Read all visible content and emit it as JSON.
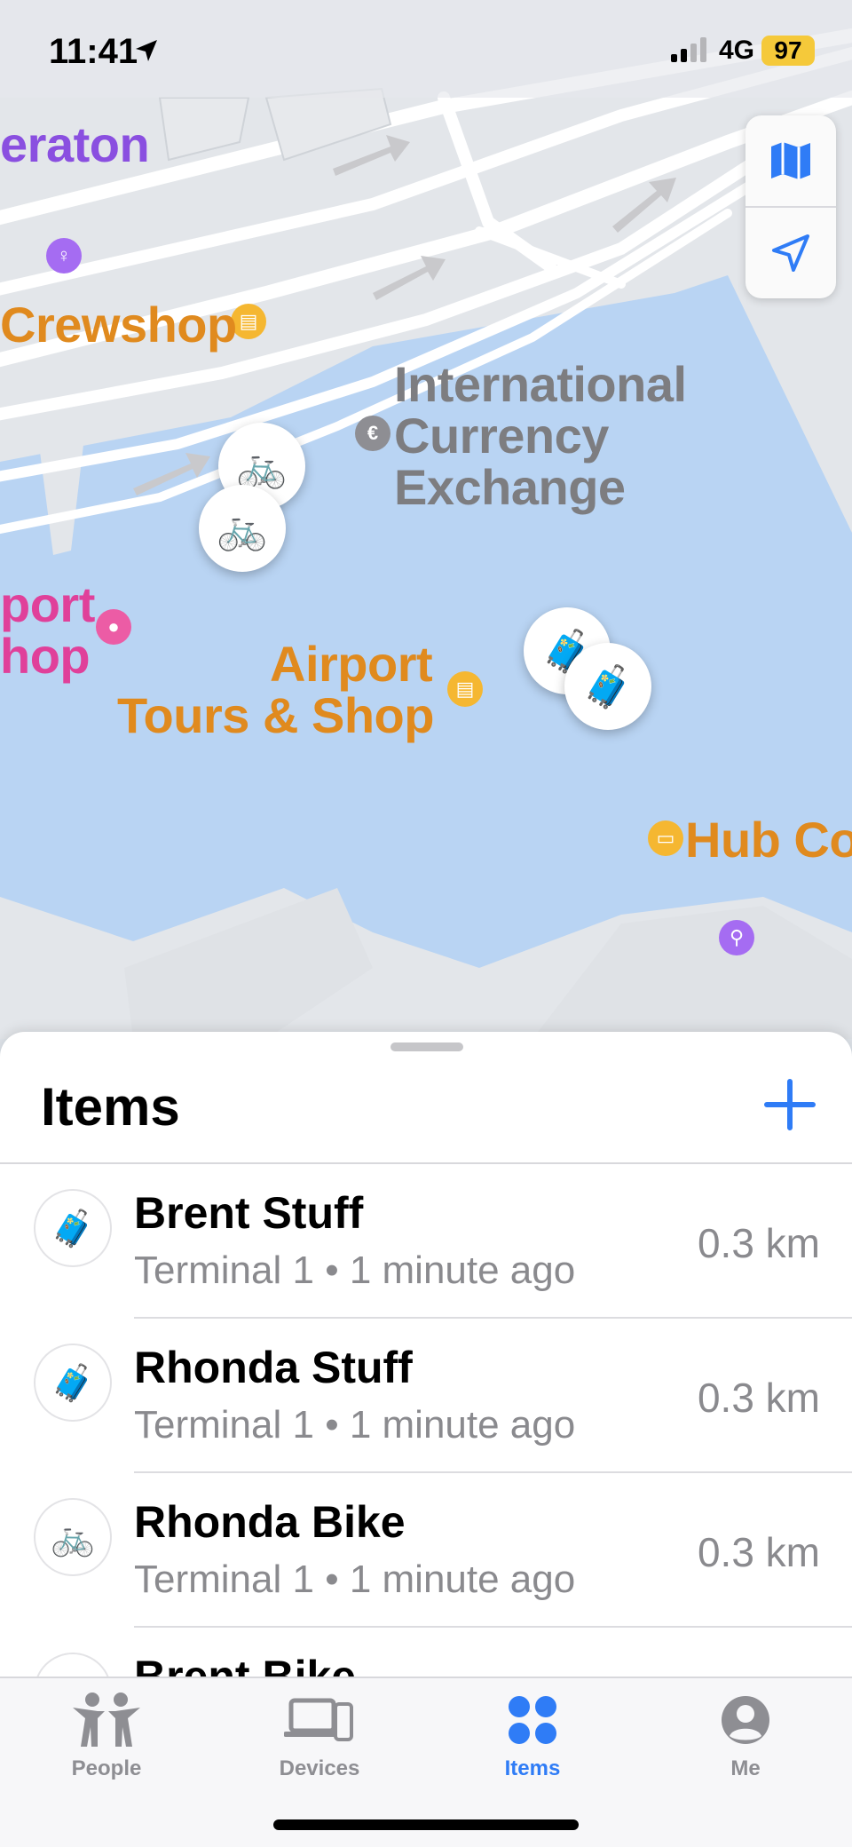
{
  "status_bar": {
    "time": "11:41",
    "network": "4G",
    "battery": "97"
  },
  "map": {
    "labels": {
      "hotel": "eraton",
      "crewshop": "Crewshop",
      "currency_line1": "International",
      "currency_line2": "Currency",
      "currency_line3": "Exchange",
      "airport_line1": "Airport",
      "airport_line2": "Tours & Shop",
      "port_line1": "port",
      "port_line2": "hop",
      "hub": "Hub Co"
    },
    "pins": {
      "bike": "🚲",
      "luggage": "🧳"
    },
    "colors": {
      "water": "#b9d4f3",
      "land": "#e3e6ea",
      "road": "#ffffff"
    }
  },
  "sheet": {
    "title": "Items",
    "items": [
      {
        "icon": "🧳",
        "name": "Brent Stuff",
        "subtitle": "Terminal 1 • 1 minute ago",
        "distance": "0.3 km"
      },
      {
        "icon": "🧳",
        "name": "Rhonda Stuff",
        "subtitle": "Terminal 1 • 1 minute ago",
        "distance": "0.3 km"
      },
      {
        "icon": "🚲",
        "name": "Rhonda Bike",
        "subtitle": "Terminal 1 • 1 minute ago",
        "distance": "0.3 km"
      },
      {
        "icon": "🚲",
        "name": "Brent Bike",
        "subtitle": "",
        "distance": ""
      }
    ]
  },
  "tabs": [
    {
      "label": "People",
      "icon": "people-icon"
    },
    {
      "label": "Devices",
      "icon": "devices-icon"
    },
    {
      "label": "Items",
      "icon": "items-icon",
      "active": true
    },
    {
      "label": "Me",
      "icon": "me-icon"
    }
  ],
  "accent_color": "#2f7cf6"
}
